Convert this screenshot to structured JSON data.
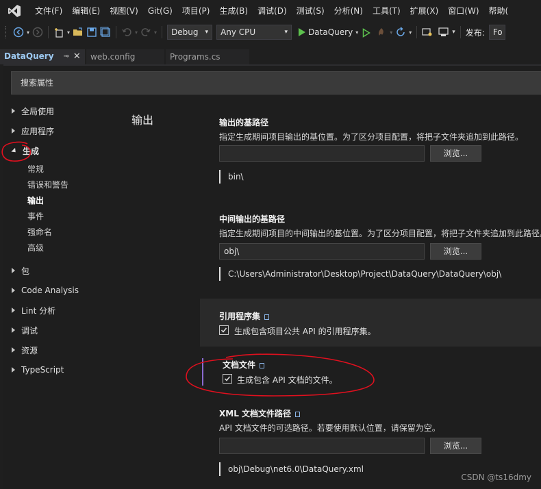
{
  "menu": {
    "items": [
      "文件(F)",
      "编辑(E)",
      "视图(V)",
      "Git(G)",
      "项目(P)",
      "生成(B)",
      "调试(D)",
      "测试(S)",
      "分析(N)",
      "工具(T)",
      "扩展(X)",
      "窗口(W)",
      "帮助("
    ]
  },
  "toolbar": {
    "config": "Debug",
    "platform": "Any CPU",
    "run_target": "DataQuery",
    "publish_label": "发布:",
    "publish_value": "Fo"
  },
  "tabs": [
    {
      "label": "DataQuery",
      "active": true
    },
    {
      "label": "web.config",
      "active": false
    },
    {
      "label": "Programs.cs",
      "active": false
    }
  ],
  "search": {
    "label": "搜索属性"
  },
  "nav": {
    "items": [
      "全局使用",
      "应用程序",
      "生成",
      "包",
      "Code Analysis",
      "Lint 分析",
      "调试",
      "资源",
      "TypeScript"
    ],
    "sub_items": [
      "常规",
      "错误和警告",
      "输出",
      "事件",
      "强命名",
      "高级"
    ]
  },
  "section": {
    "title": "输出"
  },
  "output_base": {
    "label": "输出的基路径",
    "desc": "指定生成期间项目输出的基位置。为了区分项目配置，将把子文件夹追加到此路径。",
    "value": "",
    "browse": "浏览...",
    "preview": "bin\\"
  },
  "intermediate_base": {
    "label": "中间输出的基路径",
    "desc": "指定生成期间项目的中间输出的基位置。为了区分项目配置，将把子文件夹追加到此路径。",
    "value": "obj\\",
    "browse": "浏览...",
    "preview": "C:\\Users\\Administrator\\Desktop\\Project\\DataQuery\\DataQuery\\obj\\"
  },
  "ref_assembly": {
    "label": "引用程序集",
    "checkbox_label": "生成包含项目公共 API 的引用程序集。",
    "checked": true
  },
  "doc_file": {
    "label": "文档文件",
    "checkbox_label": "生成包含 API 文档的文件。",
    "checked": true
  },
  "xml_doc_path": {
    "label": "XML 文档文件路径",
    "desc": "API 文档文件的可选路径。若要使用默认位置，请保留为空。",
    "value": "",
    "browse": "浏览...",
    "preview": "obj\\Debug\\net6.0\\DataQuery.xml"
  },
  "watermark": "CSDN @ts16dmy",
  "colors": {
    "accent": "#8a6ad1",
    "annotation": "#e0101e",
    "run": "#5dc24e",
    "link": "#8ab4e6"
  }
}
